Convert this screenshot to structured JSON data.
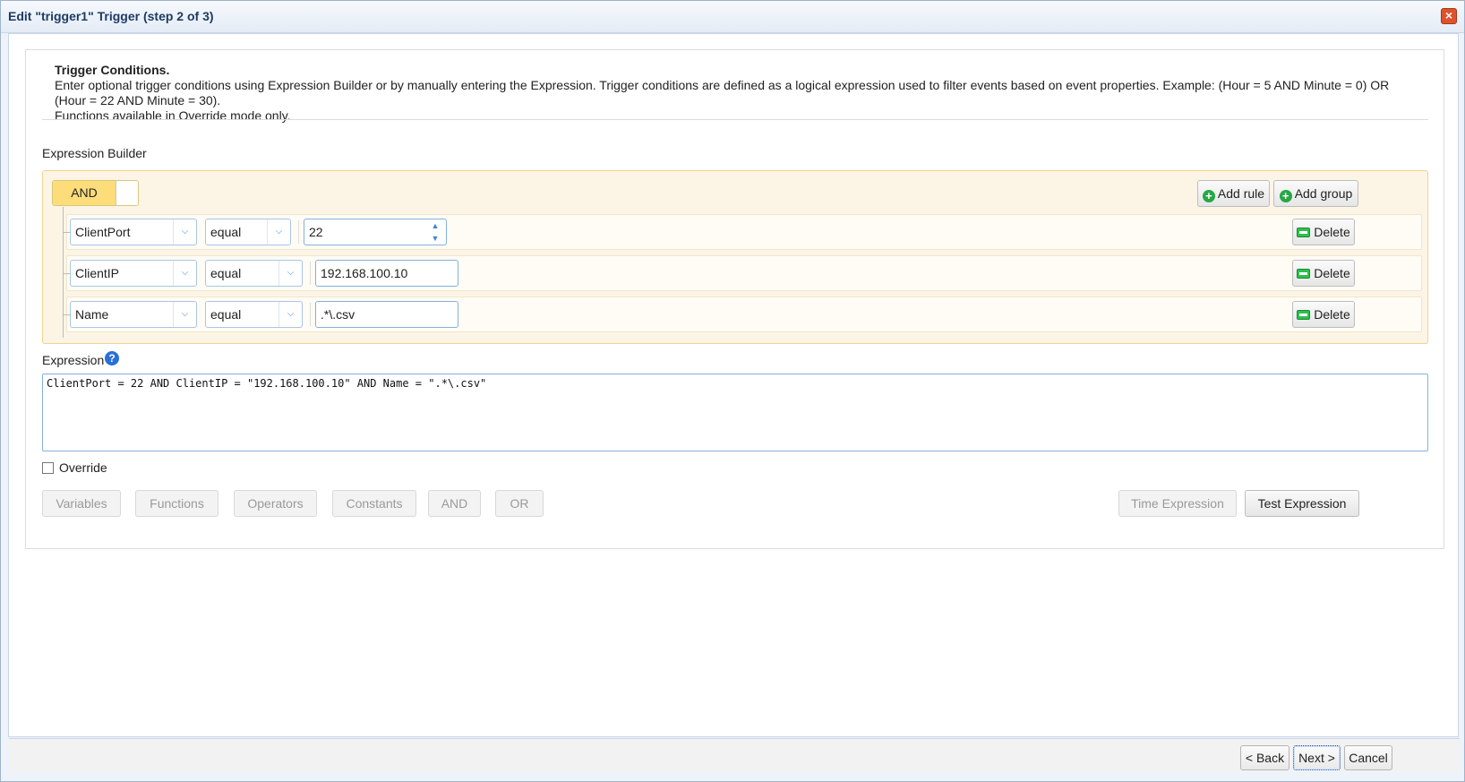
{
  "window": {
    "title": "Edit \"trigger1\" Trigger (step 2 of 3)",
    "close_icon": "close-icon"
  },
  "intro": {
    "heading": "Trigger Conditions.",
    "description": "Enter optional trigger conditions using Expression Builder or by manually entering the Expression. Trigger conditions are defined as a logical expression used to filter events based on event properties. Example: (Hour = 5 AND Minute = 0) OR (Hour = 22 AND Minute = 30).",
    "note": "Functions available in Override mode only."
  },
  "builder": {
    "label": "Expression Builder",
    "condition": "AND",
    "add_rule": "Add rule",
    "add_group": "Add group",
    "rules": [
      {
        "field": "ClientPort",
        "operator": "equal",
        "value": "22",
        "delete": "Delete"
      },
      {
        "field": "ClientIP",
        "operator": "equal",
        "value": "192.168.100.10",
        "delete": "Delete"
      },
      {
        "field": "Name",
        "operator": "equal",
        "value": ".*\\.csv",
        "delete": "Delete"
      }
    ]
  },
  "expression": {
    "label": "Expression",
    "help_icon": "help-icon",
    "value": "ClientPort = 22 AND ClientIP = \"192.168.100.10\" AND Name = \".*\\.csv\""
  },
  "override": {
    "label": "Override",
    "checked": false
  },
  "toolbar": {
    "variables": "Variables",
    "functions": "Functions",
    "operators": "Operators",
    "constants": "Constants",
    "and": "AND",
    "or": "OR",
    "time_expression": "Time Expression",
    "test_expression": "Test Expression"
  },
  "footer": {
    "back": "< Back",
    "next": "Next >",
    "cancel": "Cancel"
  },
  "colors": {
    "accent": "#fddc7a",
    "builder_bg": "#fcf5e6",
    "title": "#1f3b63"
  }
}
